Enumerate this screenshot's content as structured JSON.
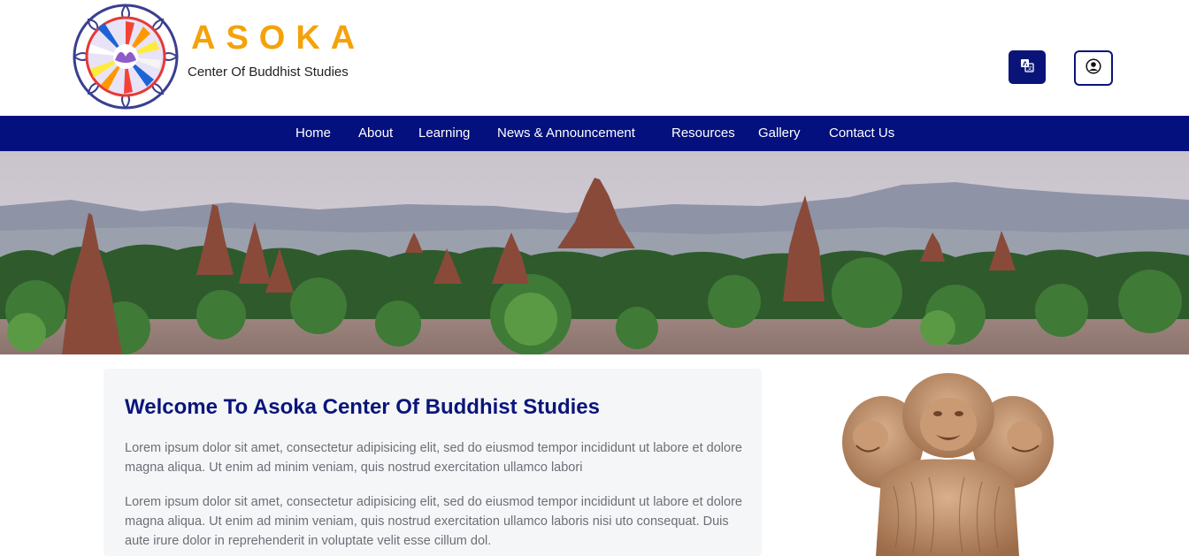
{
  "brand": {
    "title": "ASOKA",
    "subtitle": "Center Of Buddhist Studies",
    "logo_icon": "dharma-wheel-lotus-logo",
    "colors": {
      "primary": "#03107e",
      "accent": "#f5a20a"
    }
  },
  "header": {
    "translate_icon": "translate-icon",
    "user_icon": "user-circle-icon"
  },
  "nav": {
    "items": [
      {
        "label": "Home"
      },
      {
        "label": "About"
      },
      {
        "label": "Learning"
      },
      {
        "label": "News & Announcement"
      },
      {
        "label": "Resources"
      },
      {
        "label": "Gallery"
      },
      {
        "label": "Contact Us"
      }
    ]
  },
  "hero": {
    "image": "temples-landscape-photo"
  },
  "welcome": {
    "title": "Welcome To Asoka Center Of Buddhist Studies",
    "paragraphs": [
      "Lorem ipsum dolor sit amet, consectetur adipisicing elit, sed do eiusmod tempor incididunt ut labore et dolore magna aliqua. Ut enim ad minim veniam, quis nostrud exercitation ullamco labori",
      "Lorem ipsum dolor sit amet, consectetur adipisicing elit, sed do eiusmod tempor incididunt ut labore et dolore magna aliqua. Ut enim ad minim veniam, quis nostrud exercitation ullamco laboris nisi uto consequat. Duis aute irure dolor in reprehenderit in voluptate velit esse cillum dol."
    ],
    "side_image": "lion-capital-statue"
  }
}
